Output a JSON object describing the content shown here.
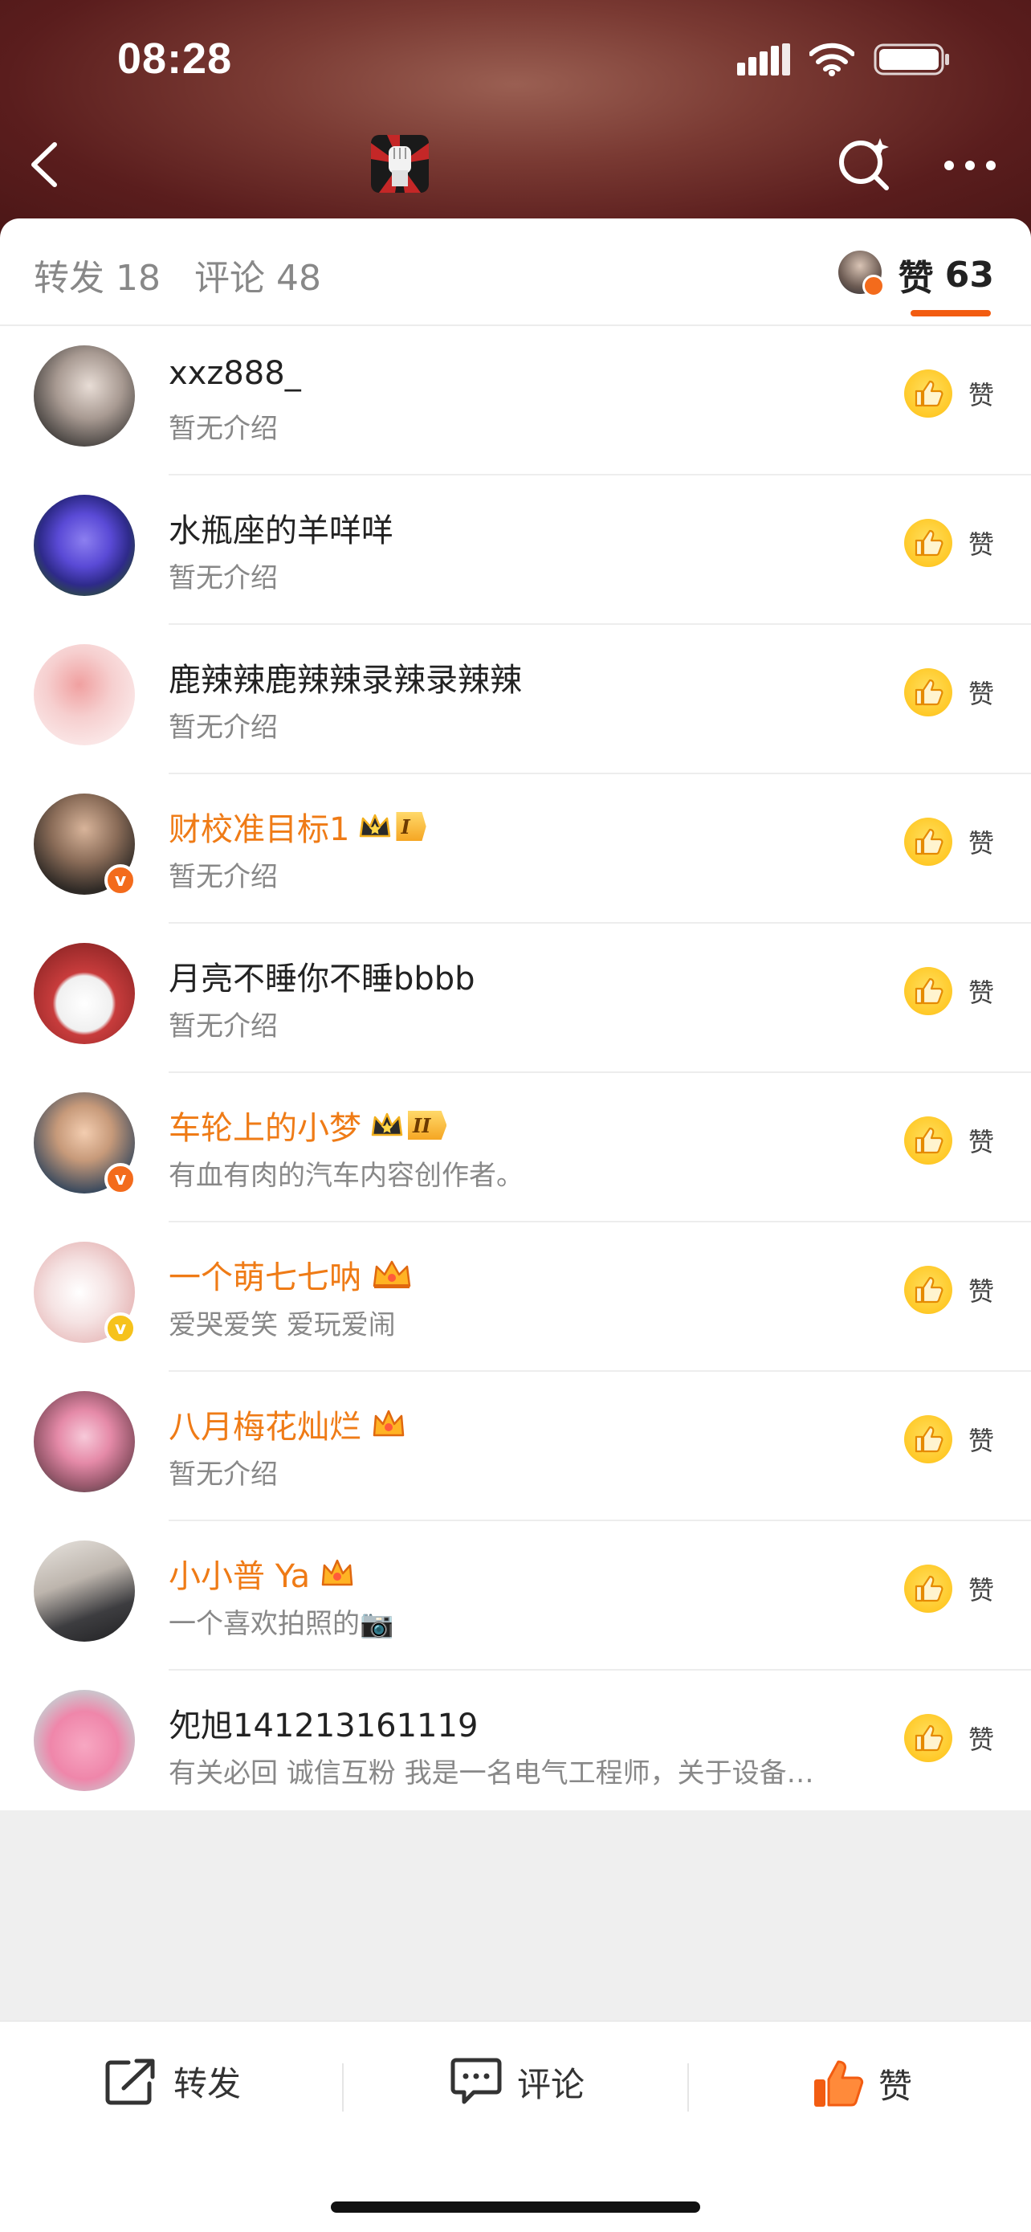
{
  "status_bar": {
    "time": "08:28"
  },
  "header": {
    "back_icon": "chevron-left-icon",
    "search_icon": "search-sparkle-icon",
    "more_icon": "more-dots-icon"
  },
  "tabs": {
    "forward_label": "转发 18",
    "comment_label": "评论 48",
    "like_label": "赞",
    "like_count": "63",
    "active_color": "#f25c11"
  },
  "users": [
    {
      "name": "xxz888_",
      "desc": "暂无介绍",
      "vip": false,
      "like_label": "赞"
    },
    {
      "name": "水瓶座的羊咩咩",
      "desc": "暂无介绍",
      "vip": false,
      "like_label": "赞"
    },
    {
      "name": "鹿辣辣鹿辣辣录辣录辣辣",
      "desc": "暂无介绍",
      "vip": false,
      "like_label": "赞"
    },
    {
      "name": "财校准目标1",
      "desc": "暂无介绍",
      "vip": true,
      "level": "I",
      "verified": "orange",
      "like_label": "赞"
    },
    {
      "name": "月亮不睡你不睡bbbb",
      "desc": "暂无介绍",
      "vip": false,
      "like_label": "赞"
    },
    {
      "name": "车轮上的小梦",
      "desc": "有血有肉的汽车内容创作者。",
      "vip": true,
      "level": "II",
      "verified": "orange",
      "like_label": "赞"
    },
    {
      "name": "一个萌七七呐",
      "desc": "爱哭爱笑 爱玩爱闹",
      "vip": true,
      "verified": "yellow",
      "like_label": "赞"
    },
    {
      "name": "八月梅花灿烂",
      "desc": "暂无介绍",
      "vip": true,
      "like_label": "赞"
    },
    {
      "name": "小小普 Ya",
      "desc": "一个喜欢拍照的📷",
      "vip": true,
      "like_label": "赞"
    },
    {
      "name": "夗旭141213161119",
      "desc": "有关必回 诚信互粉 我是一名电气工程师，关于设备…",
      "vip": false,
      "like_label": "赞"
    }
  ],
  "bottom_bar": {
    "forward_label": "转发",
    "comment_label": "评论",
    "like_label": "赞",
    "like_color": "#f25c11"
  }
}
